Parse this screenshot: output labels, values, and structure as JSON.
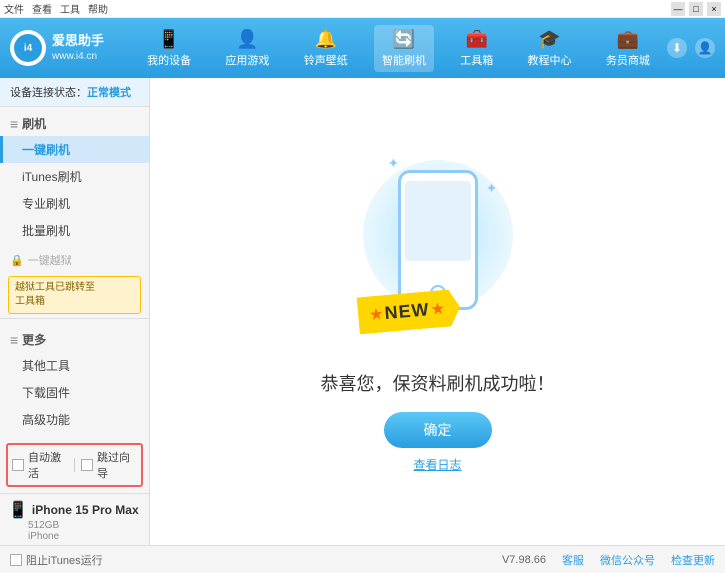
{
  "app": {
    "title": "爱思助手",
    "subtitle": "www.i4.cn"
  },
  "menubar": {
    "items": [
      "文件",
      "查看",
      "工具",
      "帮助"
    ],
    "window_controls": [
      "□",
      "—",
      "×"
    ]
  },
  "header": {
    "nav": [
      {
        "id": "my-device",
        "icon": "📱",
        "label": "我的设备"
      },
      {
        "id": "apps-games",
        "icon": "👤",
        "label": "应用游戏"
      },
      {
        "id": "ringtones",
        "icon": "🔔",
        "label": "铃声壁纸"
      },
      {
        "id": "smart-flash",
        "icon": "🔄",
        "label": "智能刷机",
        "active": true
      },
      {
        "id": "toolbox",
        "icon": "🧰",
        "label": "工具箱"
      },
      {
        "id": "tutorial",
        "icon": "🎓",
        "label": "教程中心"
      },
      {
        "id": "service",
        "icon": "💼",
        "label": "务员商城"
      }
    ],
    "download_icon": "⬇",
    "user_icon": "👤"
  },
  "sidebar": {
    "status_label": "设备连接状态：",
    "status_mode": "正常模式",
    "flash_group_label": "刷机",
    "items": [
      {
        "id": "one-key-flash",
        "label": "一键刷机",
        "active": true
      },
      {
        "id": "itunes-flash",
        "label": "iTunes刷机"
      },
      {
        "id": "pro-flash",
        "label": "专业刷机"
      },
      {
        "id": "batch-flash",
        "label": "批量刷机"
      }
    ],
    "disabled_label": "一键越狱",
    "notice_text": "越狱工具已跳转至\n工具箱",
    "more_group_label": "更多",
    "more_items": [
      {
        "id": "other-tools",
        "label": "其他工具"
      },
      {
        "id": "download-firmware",
        "label": "下载固件"
      },
      {
        "id": "advanced",
        "label": "高级功能"
      }
    ],
    "auto_activate_label": "自动激活",
    "skip_guide_label": "跳过向导",
    "device_name": "iPhone 15 Pro Max",
    "device_storage": "512GB",
    "device_type": "iPhone"
  },
  "content": {
    "success_message": "恭喜您，保资料刷机成功啦！",
    "confirm_button": "确定",
    "log_link": "查看日志",
    "new_badge": "NEW",
    "sparkles": [
      "✦",
      "✦",
      "✦"
    ]
  },
  "footer": {
    "stop_itunes_label": "阻止iTunes运行",
    "version": "V7.98.66",
    "links": [
      "客服",
      "微信公众号",
      "检查更新"
    ]
  }
}
